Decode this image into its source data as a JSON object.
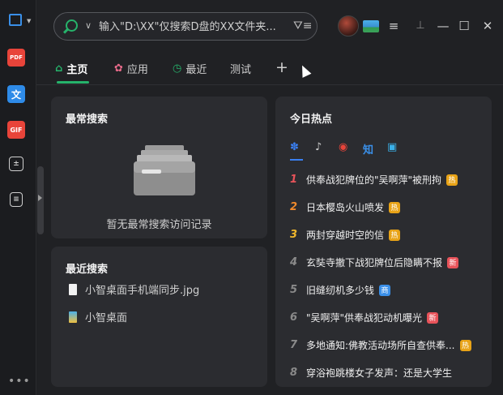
{
  "search": {
    "placeholder": "输入\"D:\\XX\"仅搜索D盘的XX文件夹..."
  },
  "rail": {
    "items": [
      {
        "name": "window-icon",
        "label": ""
      },
      {
        "name": "pdf-icon",
        "label": "PDF"
      },
      {
        "name": "translate-icon",
        "label": "文"
      },
      {
        "name": "gif-icon",
        "label": "GIF"
      },
      {
        "name": "calculator-icon",
        "label": ""
      },
      {
        "name": "notes-icon",
        "label": ""
      }
    ],
    "more": "•••"
  },
  "tabs": [
    {
      "label": "主页",
      "icon": "home-icon",
      "active": true
    },
    {
      "label": "应用",
      "icon": "apps-icon",
      "active": false
    },
    {
      "label": "最近",
      "icon": "clock-icon",
      "active": false
    },
    {
      "label": "测试",
      "icon": "",
      "active": false
    }
  ],
  "tab_add": "+",
  "frequent": {
    "title": "最常搜索",
    "empty_text": "暂无最常搜索访问记录"
  },
  "recent": {
    "title": "最近搜索",
    "items": [
      {
        "label": "小智桌面手机端同步.jpg",
        "icon": "image-file-icon"
      },
      {
        "label": "小智桌面",
        "icon": "app-file-icon"
      }
    ]
  },
  "hot": {
    "title": "今日热点",
    "sources": [
      "baidu-icon",
      "douyin-icon",
      "weibo-icon",
      "zhihu-icon",
      "bilibili-icon"
    ],
    "zhihu_label": "知",
    "items": [
      {
        "rank": "1",
        "text": "供奉战犯牌位的\"吴啊萍\"被刑拘",
        "badge": "热",
        "badge_color": "#e8a317"
      },
      {
        "rank": "2",
        "text": "日本樱岛火山喷发",
        "badge": "热",
        "badge_color": "#e8a317"
      },
      {
        "rank": "3",
        "text": "两封穿越时空的信",
        "badge": "热",
        "badge_color": "#e8a317"
      },
      {
        "rank": "4",
        "text": "玄奘寺撤下战犯牌位后隐瞒不报",
        "badge": "新",
        "badge_color": "#e8535a"
      },
      {
        "rank": "5",
        "text": "旧缝纫机多少钱",
        "badge": "商",
        "badge_color": "#3a8fe8"
      },
      {
        "rank": "6",
        "text": "\"吴啊萍\"供奉战犯动机曝光",
        "badge": "新",
        "badge_color": "#e8535a"
      },
      {
        "rank": "7",
        "text": "多地通知:佛教活动场所自查供奉...",
        "badge": "热",
        "badge_color": "#e8a317"
      },
      {
        "rank": "8",
        "text": "穿浴袍跳楼女子发声：还是大学生",
        "badge": "",
        "badge_color": ""
      }
    ]
  },
  "colors": {
    "accent": "#26b36b",
    "rank1": "#e8535a",
    "rank2": "#f08a2c",
    "rank3": "#f0b72c"
  }
}
